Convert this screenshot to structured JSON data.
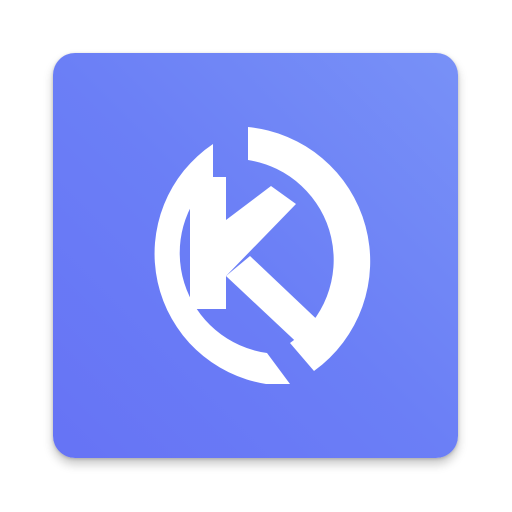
{
  "app_icon": {
    "icon": "k-circle-logo-icon",
    "background_colors": [
      "#6673f5",
      "#7891f7"
    ],
    "glyph_color": "#ffffff"
  }
}
